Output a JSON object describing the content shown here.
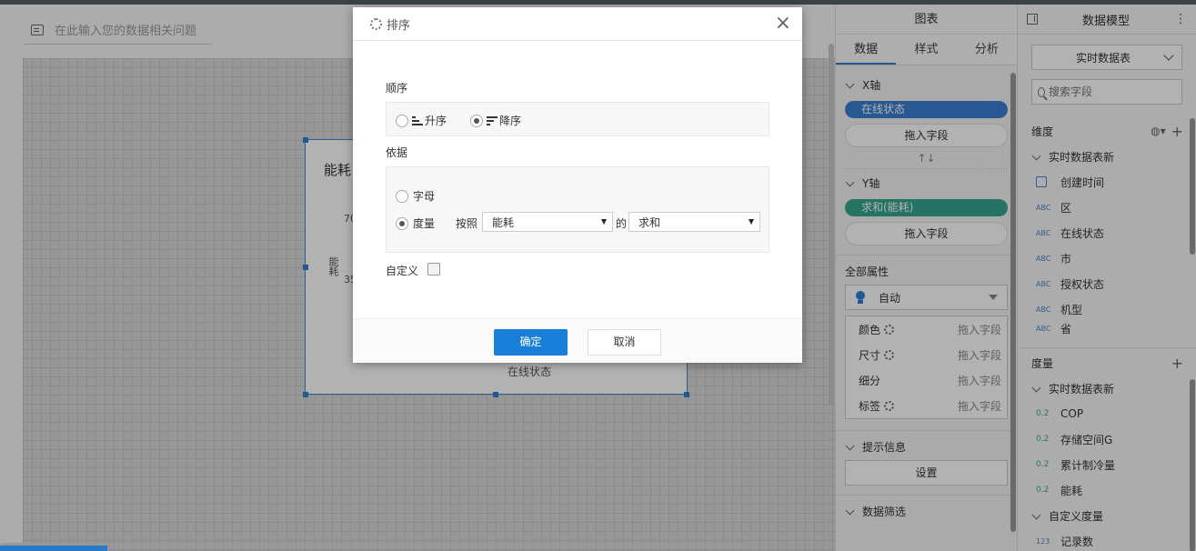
{
  "ask": {
    "placeholder": "在此输入您的数据相关问题"
  },
  "chart": {
    "title": "能耗",
    "tick_top": "70",
    "tick_mid": "35",
    "ylabel": "能耗",
    "xlabel": "在线状态"
  },
  "config": {
    "header": "图表",
    "tabs": [
      "数据",
      "样式",
      "分析"
    ],
    "x_axis": {
      "label": "X轴",
      "field": "在线状态",
      "drop": "拖入字段",
      "color": "#3a7fd0"
    },
    "swap": "↑↓",
    "y_axis": {
      "label": "Y轴",
      "field": "求和(能耗)",
      "drop": "拖入字段",
      "color": "#35a78f"
    },
    "all_props": {
      "label": "全部属性",
      "mode": "自动"
    },
    "props": [
      {
        "name": "颜色",
        "drop": "拖入字段"
      },
      {
        "name": "尺寸",
        "drop": "拖入字段"
      },
      {
        "name": "细分",
        "drop": "拖入字段"
      },
      {
        "name": "标签",
        "drop": "拖入字段"
      }
    ],
    "hint": {
      "label": "提示信息",
      "button": "设置"
    },
    "filter": "数据筛选"
  },
  "model": {
    "header": "数据模型",
    "dots": "⋮",
    "table_select": "实时数据表",
    "search_placeholder": "搜索字段",
    "dim_label": "维度",
    "dim_group": "实时数据表新",
    "dims": [
      {
        "tag": "",
        "name": "创建时间"
      },
      {
        "tag": "ABC",
        "name": "区"
      },
      {
        "tag": "ABC",
        "name": "在线状态"
      },
      {
        "tag": "ABC",
        "name": "市"
      },
      {
        "tag": "ABC",
        "name": "授权状态"
      },
      {
        "tag": "ABC",
        "name": "机型"
      },
      {
        "tag": "ABC",
        "name": "省"
      }
    ],
    "measure_label": "度量",
    "measure_group": "实时数据表新",
    "measures": [
      {
        "tag": "0.2",
        "name": "COP"
      },
      {
        "tag": "0.2",
        "name": "存储空间G"
      },
      {
        "tag": "0.2",
        "name": "累计制冷量"
      },
      {
        "tag": "0.2",
        "name": "能耗"
      }
    ],
    "custom_group": "自定义度量",
    "custom": [
      {
        "tag": "123",
        "name": "记录数"
      }
    ]
  },
  "modal": {
    "title": "排序",
    "order_label": "顺序",
    "asc": "升序",
    "desc": "降序",
    "selected_order": "desc",
    "basis_label": "依据",
    "letter": "字母",
    "measure": "度量",
    "by": "按照",
    "field_value": "能耗",
    "of": "的",
    "agg_value": "求和",
    "custom_label": "自定义",
    "ok": "确定",
    "cancel": "取消"
  }
}
